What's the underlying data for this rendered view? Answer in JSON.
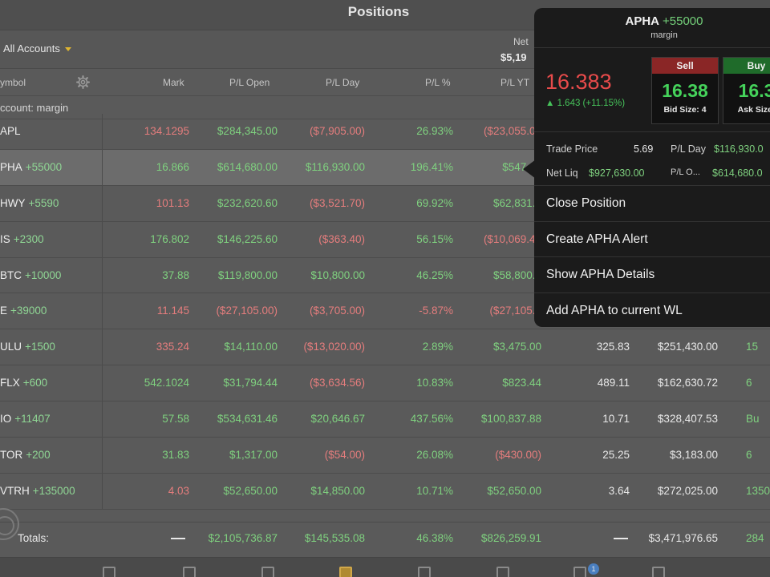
{
  "header": {
    "title": "Positions"
  },
  "account_bar": {
    "account_label": "All Accounts",
    "netliq_label": "Net",
    "netliq_value": "$5,19"
  },
  "columns": {
    "symbol": "ymbol",
    "mark": "Mark",
    "pl_open": "P/L Open",
    "pl_day": "P/L Day",
    "pl_pct": "P/L %",
    "pl_ytd": "P/L YT"
  },
  "group": {
    "label": "ccount: margin"
  },
  "rows": [
    {
      "symbol": "APL",
      "qty": "",
      "mark": "134.1295",
      "mark_color": "r",
      "pl_open": "$284,345.00",
      "pl_open_color": "g",
      "pl_day": "($7,905.00)",
      "pl_day_color": "r",
      "pl_pct": "26.93%",
      "pl_pct_color": "g",
      "pl_ytd": "($23,055.00",
      "pl_ytd_color": "r",
      "c1": "",
      "c2": "",
      "c3": "",
      "c3_color": "g"
    },
    {
      "symbol": "PHA",
      "qty": "+55000",
      "mark": "16.866",
      "mark_color": "g",
      "pl_open": "$614,680.00",
      "pl_open_color": "g",
      "pl_day": "$116,930.00",
      "pl_day_color": "g",
      "pl_pct": "196.41%",
      "pl_pct_color": "g",
      "pl_ytd": "$547,03",
      "pl_ytd_color": "g",
      "c1": "",
      "c2": "",
      "c3": "",
      "c3_color": "g"
    },
    {
      "symbol": "HWY",
      "qty": "+5590",
      "mark": "101.13",
      "mark_color": "r",
      "pl_open": "$232,620.60",
      "pl_open_color": "g",
      "pl_day": "($3,521.70)",
      "pl_day_color": "r",
      "pl_pct": "69.92%",
      "pl_pct_color": "g",
      "pl_ytd": "$62,831.6",
      "pl_ytd_color": "g",
      "c1": "",
      "c2": "",
      "c3": "",
      "c3_color": "g"
    },
    {
      "symbol": "IS",
      "qty": "+2300",
      "mark": "176.802",
      "mark_color": "g",
      "pl_open": "$146,225.60",
      "pl_open_color": "g",
      "pl_day": "($363.40)",
      "pl_day_color": "r",
      "pl_pct": "56.15%",
      "pl_pct_color": "g",
      "pl_ytd": "($10,069.40",
      "pl_ytd_color": "r",
      "c1": "",
      "c2": "",
      "c3": "",
      "c3_color": "g"
    },
    {
      "symbol": "BTC",
      "qty": "+10000",
      "mark": "37.88",
      "mark_color": "g",
      "pl_open": "$119,800.00",
      "pl_open_color": "g",
      "pl_day": "$10,800.00",
      "pl_day_color": "g",
      "pl_pct": "46.25%",
      "pl_pct_color": "g",
      "pl_ytd": "$58,800.0",
      "pl_ytd_color": "g",
      "c1": "",
      "c2": "",
      "c3": "",
      "c3_color": "g"
    },
    {
      "symbol": "E",
      "qty": "+39000",
      "mark": "11.145",
      "mark_color": "r",
      "pl_open": "($27,105.00)",
      "pl_open_color": "r",
      "pl_day": "($3,705.00)",
      "pl_day_color": "r",
      "pl_pct": "-5.87%",
      "pl_pct_color": "r",
      "pl_ytd": "($27,105.0",
      "pl_ytd_color": "r",
      "c1": "",
      "c2": "",
      "c3": "",
      "c3_color": "g"
    },
    {
      "symbol": "ULU",
      "qty": "+1500",
      "mark": "335.24",
      "mark_color": "r",
      "pl_open": "$14,110.00",
      "pl_open_color": "g",
      "pl_day": "($13,020.00)",
      "pl_day_color": "r",
      "pl_pct": "2.89%",
      "pl_pct_color": "g",
      "pl_ytd": "$3,475.00",
      "pl_ytd_color": "g",
      "c1": "325.83",
      "c2": "$251,430.00",
      "c3": "15",
      "c3_color": "g"
    },
    {
      "symbol": "FLX",
      "qty": "+600",
      "mark": "542.1024",
      "mark_color": "g",
      "pl_open": "$31,794.44",
      "pl_open_color": "g",
      "pl_day": "($3,634.56)",
      "pl_day_color": "r",
      "pl_pct": "10.83%",
      "pl_pct_color": "g",
      "pl_ytd": "$823.44",
      "pl_ytd_color": "g",
      "c1": "489.11",
      "c2": "$162,630.72",
      "c3": "6",
      "c3_color": "g"
    },
    {
      "symbol": "IO",
      "qty": "+11407",
      "mark": "57.58",
      "mark_color": "g",
      "pl_open": "$534,631.46",
      "pl_open_color": "g",
      "pl_day": "$20,646.67",
      "pl_day_color": "g",
      "pl_pct": "437.56%",
      "pl_pct_color": "g",
      "pl_ytd": "$100,837.88",
      "pl_ytd_color": "g",
      "c1": "10.71",
      "c2": "$328,407.53",
      "c3": "Bu",
      "c3_color": "g"
    },
    {
      "symbol": "TOR",
      "qty": "+200",
      "mark": "31.83",
      "mark_color": "g",
      "pl_open": "$1,317.00",
      "pl_open_color": "g",
      "pl_day": "($54.00)",
      "pl_day_color": "r",
      "pl_pct": "26.08%",
      "pl_pct_color": "g",
      "pl_ytd": "($430.00)",
      "pl_ytd_color": "r",
      "c1": "25.25",
      "c2": "$3,183.00",
      "c3": "6",
      "c3_color": "g"
    },
    {
      "symbol": "VTRH",
      "qty": "+135000",
      "mark": "4.03",
      "mark_color": "r",
      "pl_open": "$52,650.00",
      "pl_open_color": "g",
      "pl_day": "$14,850.00",
      "pl_day_color": "g",
      "pl_pct": "10.71%",
      "pl_pct_color": "g",
      "pl_ytd": "$52,650.00",
      "pl_ytd_color": "g",
      "c1": "3.64",
      "c2": "$272,025.00",
      "c3": "1350",
      "c3_color": "g"
    }
  ],
  "totals": {
    "label": "Totals:",
    "pl_open": "$2,105,736.87",
    "pl_day": "$145,535.08",
    "pl_pct": "46.38%",
    "pl_ytd": "$826,259.91",
    "c2": "$3,471,976.65",
    "c3": "284"
  },
  "tab_bar": {
    "tabs": [
      "tab-1-icon",
      "tab-2-icon",
      "tab-3-icon",
      "tab-positions-icon",
      "tab-5-icon",
      "tab-6-icon",
      "tab-7-icon",
      "tab-8-icon"
    ],
    "badge": "1"
  },
  "popover": {
    "symbol": "APHA",
    "qty": "+55000",
    "account": "margin",
    "last": "16.383",
    "change": "▲ 1.643 (+11.15%)",
    "sell_label": "Sell",
    "sell_price": "16.38",
    "bid_size": "Bid Size: 4",
    "buy_label": "Buy",
    "buy_price": "16.3",
    "ask_size": "Ask Size:",
    "trade_price_label": "Trade Price",
    "trade_price_value": "5.69",
    "pl_day_label": "P/L Day",
    "pl_day_value": "$116,930.0",
    "net_liq_label": "Net Liq",
    "net_liq_value": "$927,630.00",
    "pl_open_label": "P/L O...",
    "pl_open_value": "$614,680.0",
    "menu": [
      "Close Position",
      "Create APHA Alert",
      "Show APHA Details",
      "Add APHA to current WL"
    ]
  },
  "colors": {
    "green": "#7fd17f",
    "red": "#e57d7d",
    "popover_bg": "#1b1b1b",
    "last_price_red": "#e84b4b"
  }
}
